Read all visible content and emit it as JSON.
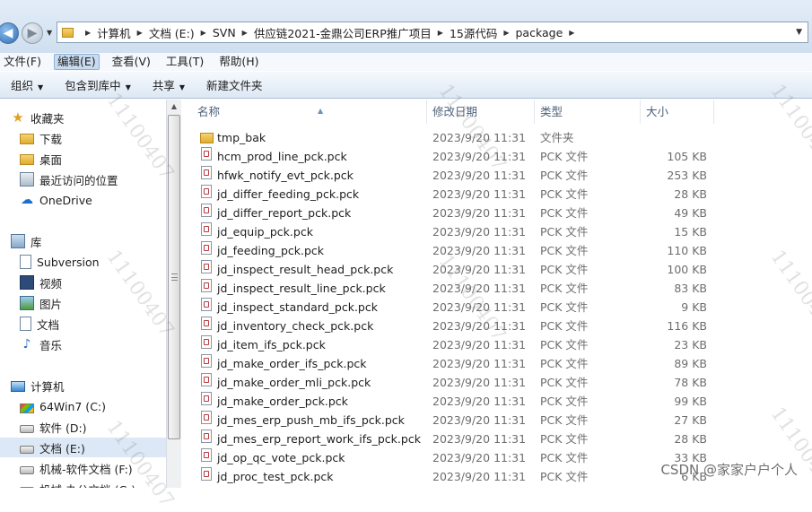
{
  "address": {
    "crumbs": [
      "计算机",
      "文档 (E:)",
      "SVN",
      "供应链2021-金鼎公司ERP推广项目",
      "15源代码",
      "package"
    ]
  },
  "menu": [
    "文件(F)",
    "编辑(E)",
    "查看(V)",
    "工具(T)",
    "帮助(H)"
  ],
  "commands": {
    "organize": "组织",
    "include_library": "包含到库中",
    "share": "共享",
    "new_folder": "新建文件夹"
  },
  "nav": {
    "favorites": "收藏夹",
    "downloads": "下载",
    "desktop": "桌面",
    "recent": "最近访问的位置",
    "onedrive": "OneDrive",
    "libraries": "库",
    "subversion": "Subversion",
    "videos": "视频",
    "pictures": "图片",
    "documents": "文档",
    "music": "音乐",
    "computer": "计算机",
    "drive_c": "64Win7   (C:)",
    "drive_d": "软件 (D:)",
    "drive_e": "文档 (E:)",
    "drive_f": "机械-软件文档 (F:)",
    "drive_g": "机械-办公文档 (G:)"
  },
  "columns": {
    "name": "名称",
    "modified": "修改日期",
    "type": "类型",
    "size": "大小"
  },
  "files": [
    {
      "name": "tmp_bak",
      "modified": "2023/9/20 11:31",
      "type": "文件夹",
      "size": "",
      "kind": "folder"
    },
    {
      "name": "hcm_prod_line_pck.pck",
      "modified": "2023/9/20 11:31",
      "type": "PCK 文件",
      "size": "105 KB",
      "kind": "file"
    },
    {
      "name": "hfwk_notify_evt_pck.pck",
      "modified": "2023/9/20 11:31",
      "type": "PCK 文件",
      "size": "253 KB",
      "kind": "file"
    },
    {
      "name": "jd_differ_feeding_pck.pck",
      "modified": "2023/9/20 11:31",
      "type": "PCK 文件",
      "size": "28 KB",
      "kind": "file"
    },
    {
      "name": "jd_differ_report_pck.pck",
      "modified": "2023/9/20 11:31",
      "type": "PCK 文件",
      "size": "49 KB",
      "kind": "file"
    },
    {
      "name": "jd_equip_pck.pck",
      "modified": "2023/9/20 11:31",
      "type": "PCK 文件",
      "size": "15 KB",
      "kind": "file"
    },
    {
      "name": "jd_feeding_pck.pck",
      "modified": "2023/9/20 11:31",
      "type": "PCK 文件",
      "size": "110 KB",
      "kind": "file"
    },
    {
      "name": "jd_inspect_result_head_pck.pck",
      "modified": "2023/9/20 11:31",
      "type": "PCK 文件",
      "size": "100 KB",
      "kind": "file"
    },
    {
      "name": "jd_inspect_result_line_pck.pck",
      "modified": "2023/9/20 11:31",
      "type": "PCK 文件",
      "size": "83 KB",
      "kind": "file"
    },
    {
      "name": "jd_inspect_standard_pck.pck",
      "modified": "2023/9/20 11:31",
      "type": "PCK 文件",
      "size": "9 KB",
      "kind": "file"
    },
    {
      "name": "jd_inventory_check_pck.pck",
      "modified": "2023/9/20 11:31",
      "type": "PCK 文件",
      "size": "116 KB",
      "kind": "file"
    },
    {
      "name": "jd_item_ifs_pck.pck",
      "modified": "2023/9/20 11:31",
      "type": "PCK 文件",
      "size": "23 KB",
      "kind": "file"
    },
    {
      "name": "jd_make_order_ifs_pck.pck",
      "modified": "2023/9/20 11:31",
      "type": "PCK 文件",
      "size": "89 KB",
      "kind": "file"
    },
    {
      "name": "jd_make_order_mli_pck.pck",
      "modified": "2023/9/20 11:31",
      "type": "PCK 文件",
      "size": "78 KB",
      "kind": "file"
    },
    {
      "name": "jd_make_order_pck.pck",
      "modified": "2023/9/20 11:31",
      "type": "PCK 文件",
      "size": "99 KB",
      "kind": "file"
    },
    {
      "name": "jd_mes_erp_push_mb_ifs_pck.pck",
      "modified": "2023/9/20 11:31",
      "type": "PCK 文件",
      "size": "27 KB",
      "kind": "file"
    },
    {
      "name": "jd_mes_erp_report_work_ifs_pck.pck",
      "modified": "2023/9/20 11:31",
      "type": "PCK 文件",
      "size": "28 KB",
      "kind": "file"
    },
    {
      "name": "jd_op_qc_vote_pck.pck",
      "modified": "2023/9/20 11:31",
      "type": "PCK 文件",
      "size": "33 KB",
      "kind": "file"
    },
    {
      "name": "jd_proc_test_pck.pck",
      "modified": "2023/9/20 11:31",
      "type": "PCK 文件",
      "size": "6 KB",
      "kind": "file"
    }
  ],
  "watermarks": {
    "diagonal": "11100407",
    "csdn": "CSDN @家家户户个人"
  }
}
